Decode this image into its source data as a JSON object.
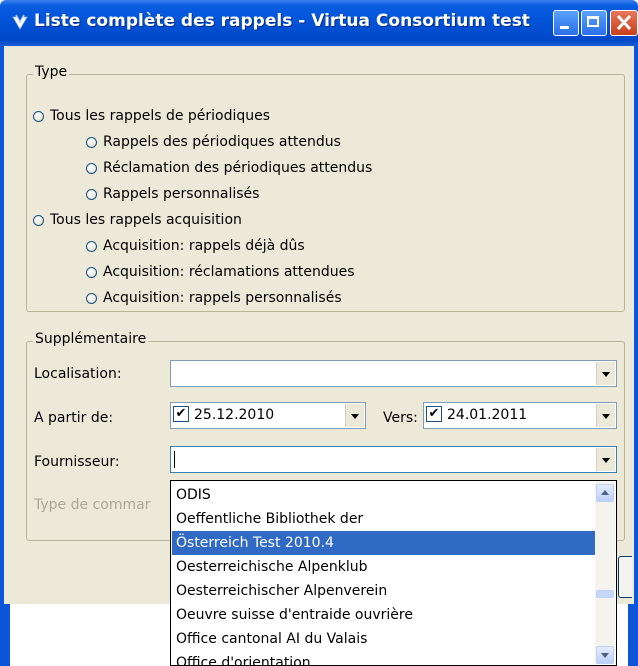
{
  "window": {
    "title": "Liste complète des rappels - Virtua Consortium test"
  },
  "type_group": {
    "legend": "Type",
    "options": [
      {
        "label": "Tous les rappels de périodiques"
      },
      {
        "label": "Rappels des périodiques attendus"
      },
      {
        "label": "Réclamation des périodiques attendus"
      },
      {
        "label": "Rappels personnalisés"
      },
      {
        "label": "Tous les rappels acquisition"
      },
      {
        "label": "Acquisition: rappels déjà dûs"
      },
      {
        "label": "Acquisition: réclamations attendues"
      },
      {
        "label": "Acquisition: rappels personnalisés"
      }
    ]
  },
  "extra_group": {
    "legend": "Supplémentaire",
    "localisation_label": "Localisation:",
    "localisation_value": "",
    "from_label": "A partir de:",
    "from_checked": true,
    "from_date": "25.12.2010",
    "to_label": "Vers:",
    "to_checked": true,
    "to_date": "24.01.2011",
    "supplier_label": "Fournisseur:",
    "supplier_value": "",
    "order_type_label": "Type de commar"
  },
  "dropdown": {
    "items": [
      {
        "label": "ODIS"
      },
      {
        "label": "Oeffentliche Bibliothek der"
      },
      {
        "label": "Österreich Test 2010.4"
      },
      {
        "label": "Oesterreichische Alpenklub"
      },
      {
        "label": "Oesterreichischer Alpenverein"
      },
      {
        "label": "Oeuvre suisse d'entraide ouvrière"
      },
      {
        "label": "Office cantonal AI du Valais"
      },
      {
        "label": "Office d'orientation"
      }
    ],
    "selected_index": 2
  },
  "colors": {
    "titlebar": "#0052d6",
    "dialog_bg": "#ece9d8",
    "selection": "#316ac5"
  },
  "icons": {
    "title": "virtua-app-icon",
    "minimize": "minimize-icon",
    "maximize": "maximize-icon",
    "close": "close-icon"
  }
}
